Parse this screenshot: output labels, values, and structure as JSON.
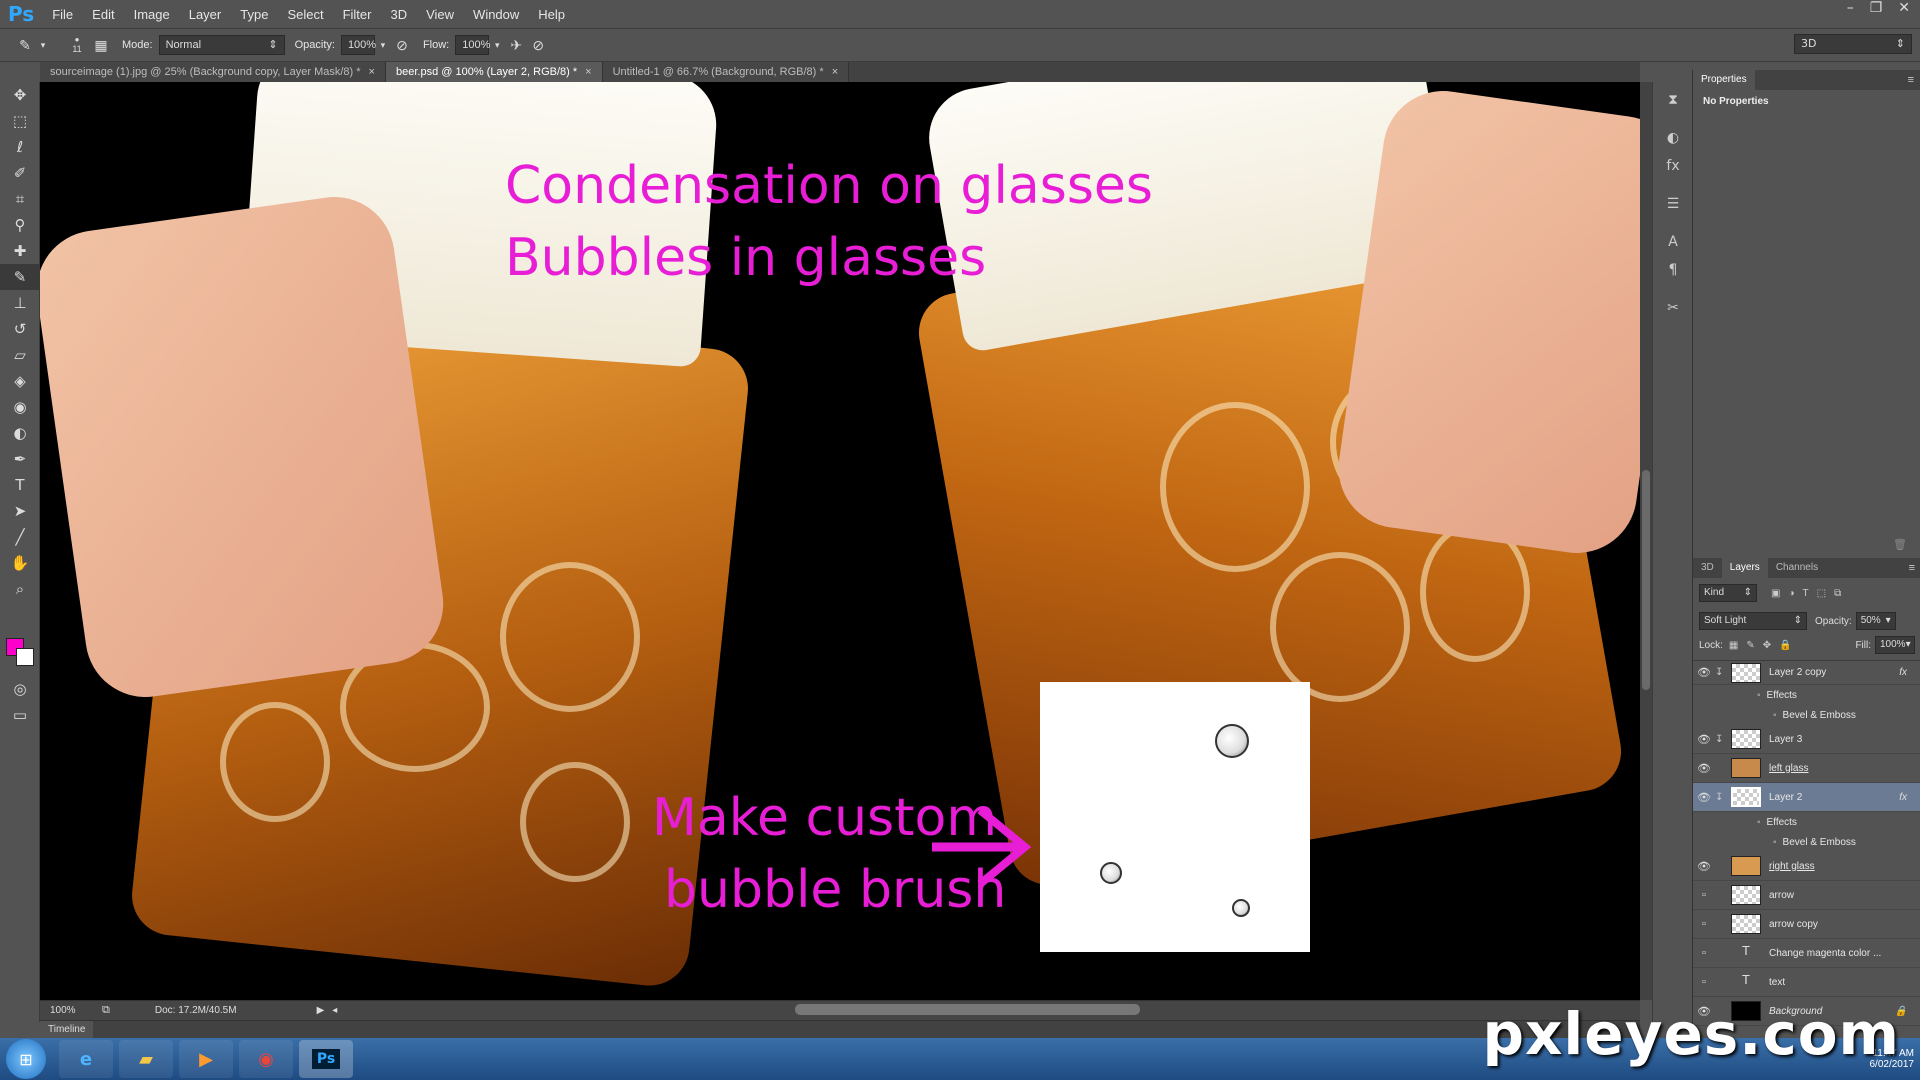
{
  "app": {
    "logo": "Ps"
  },
  "menu": [
    "File",
    "Edit",
    "Image",
    "Layer",
    "Type",
    "Select",
    "Filter",
    "3D",
    "View",
    "Window",
    "Help"
  ],
  "window_controls": [
    "–",
    "❐",
    "✕"
  ],
  "options": {
    "brush_size": "11",
    "mode_label": "Mode:",
    "mode_value": "Normal",
    "opacity_label": "Opacity:",
    "opacity_value": "100%",
    "flow_label": "Flow:",
    "flow_value": "100%",
    "workspace": "3D"
  },
  "tabs": [
    {
      "label": "sourceimage (1).jpg @ 25% (Background copy, Layer Mask/8) *",
      "active": false
    },
    {
      "label": "beer.psd @ 100% (Layer 2, RGB/8) *",
      "active": true
    },
    {
      "label": "Untitled-1 @ 66.7% (Background, RGB/8) *",
      "active": false
    }
  ],
  "tab_close": "×",
  "colors": {
    "foreground": "#ff00cc",
    "background": "#ffffff",
    "annotation": "#e81ed6"
  },
  "canvas": {
    "line1": "Condensation on glasses",
    "line2": "Bubbles in glasses",
    "line3": "Make custom",
    "line4": "bubble brush"
  },
  "status": {
    "zoom": "100%",
    "doc": "Doc: 17.2M/40.5M"
  },
  "timeline": "Timeline",
  "properties": {
    "tab": "Properties",
    "content": "No Properties"
  },
  "layers_panel": {
    "tabs": [
      "3D",
      "Layers",
      "Channels"
    ],
    "kind": "Kind",
    "blend": "Soft Light",
    "opacity_label": "Opacity:",
    "opacity_value": "50%",
    "lock_label": "Lock:",
    "fill_label": "Fill:",
    "fill_value": "100%",
    "effects_label": "Effects",
    "bevel_label": "Bevel & Emboss",
    "fx": "fx",
    "layers": {
      "layer2copy": "Layer 2 copy",
      "layer3": "Layer 3",
      "leftglass": "left glass",
      "layer2": "Layer 2",
      "rightglass": "right glass",
      "arrow": "arrow",
      "arrowcopy": "arrow copy",
      "change": "Change magenta color ...",
      "text": "text",
      "background": "Background"
    }
  },
  "taskbar": {
    "time": "11:47 AM",
    "date": "6/02/2017"
  },
  "watermark": "pxleyes.com"
}
